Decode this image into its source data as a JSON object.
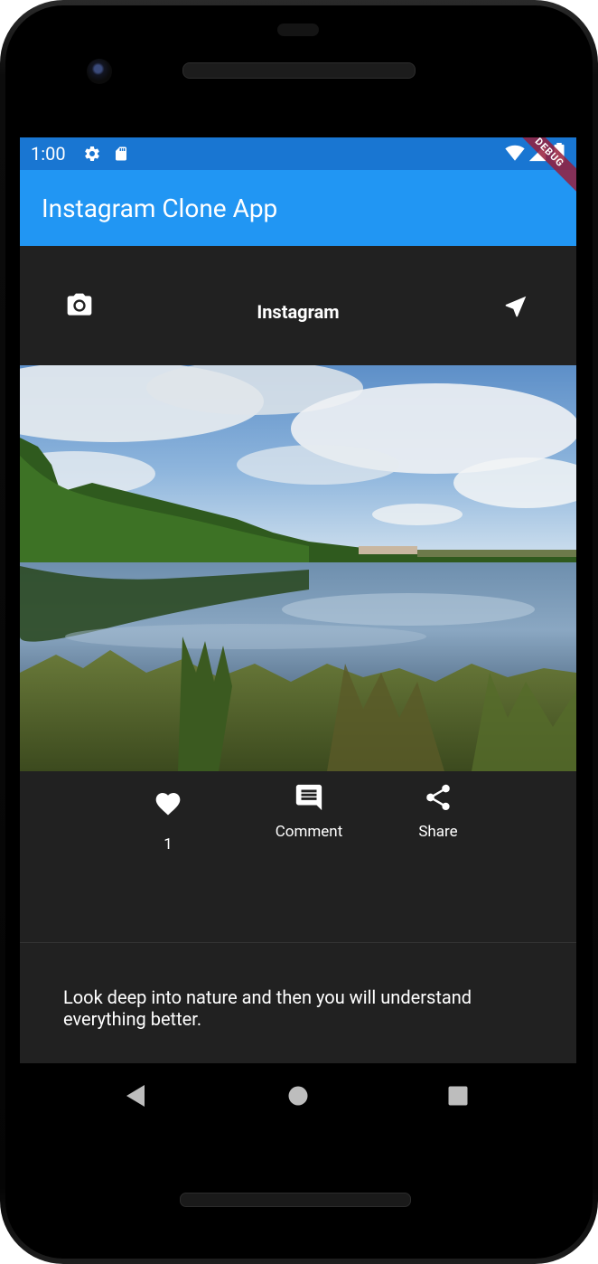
{
  "status_bar": {
    "time": "1:00"
  },
  "appbar": {
    "title": "Instagram Clone App",
    "debug_banner": "DEBUG"
  },
  "post_header": {
    "title": "Instagram"
  },
  "actions": {
    "likes": "1",
    "comment_label": "Comment",
    "share_label": "Share"
  },
  "caption": "Look deep into nature and then you will understand everything better.",
  "colors": {
    "status_bar": "#1976d2",
    "appbar": "#2196f3",
    "background": "#212121",
    "text": "#ffffff"
  },
  "icons": [
    "settings-icon",
    "sd-card-icon",
    "wifi-icon",
    "signal-icon",
    "battery-icon",
    "camera-icon",
    "send-icon",
    "heart-icon",
    "comment-icon",
    "share-icon",
    "back-icon",
    "home-icon",
    "recents-icon"
  ]
}
